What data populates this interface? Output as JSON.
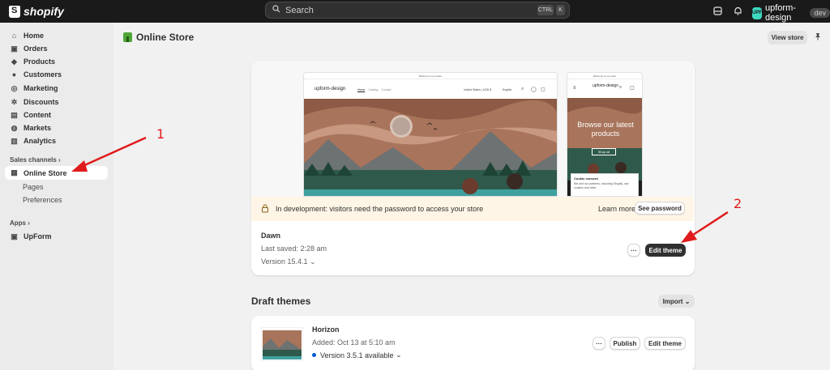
{
  "topbar": {
    "logo_text": "shopify",
    "search_placeholder": "Search",
    "shortcut_ctrl": "CTRL",
    "shortcut_k": "K",
    "store_initials": "UPF",
    "store_name": "upform-design",
    "store_badge": "dev"
  },
  "sidebar": {
    "items": [
      {
        "label": "Home",
        "icon": "home-icon"
      },
      {
        "label": "Orders",
        "icon": "orders-icon"
      },
      {
        "label": "Products",
        "icon": "tag-icon"
      },
      {
        "label": "Customers",
        "icon": "person-icon"
      },
      {
        "label": "Marketing",
        "icon": "target-icon"
      },
      {
        "label": "Discounts",
        "icon": "gear-icon"
      },
      {
        "label": "Content",
        "icon": "file-icon"
      },
      {
        "label": "Markets",
        "icon": "globe-icon"
      },
      {
        "label": "Analytics",
        "icon": "chart-icon"
      }
    ],
    "sales_channels_label": "Sales channels",
    "online_store_label": "Online Store",
    "online_store_sub": [
      "Pages",
      "Preferences"
    ],
    "apps_label": "Apps",
    "upform_label": "UpForm"
  },
  "header": {
    "title": "Online Store",
    "view_store_label": "View store"
  },
  "preview": {
    "announcement": "Welcome to our store",
    "site_name": "upform-design",
    "nav_links": [
      "Home",
      "Catalog",
      "Contact"
    ],
    "locale": "United States | USD $",
    "language": "English",
    "mobile_site_name": "upform-design",
    "mobile_hero_text": "Browse our latest products",
    "mobile_shop_button": "Shop all",
    "cookie_title": "Cookie consent",
    "cookie_text": "We and our partners, including Shopify, use cookies and other"
  },
  "dev_banner": {
    "message": "In development: visitors need the password to access your store",
    "learn_more_label": "Learn more",
    "see_password_label": "See password"
  },
  "current_theme": {
    "name": "Dawn",
    "last_saved": "Last saved: 2:28 am",
    "version": "Version 15.4.1",
    "more_label": "···",
    "edit_label": "Edit theme"
  },
  "drafts": {
    "title": "Draft themes",
    "import_label": "Import",
    "items": [
      {
        "name": "Horizon",
        "added": "Added: Oct 13 at 5:10 am",
        "version": "Version 3.5.1 available",
        "more_label": "···",
        "publish_label": "Publish",
        "edit_label": "Edit theme"
      }
    ]
  },
  "annotations": {
    "label_1": "1",
    "label_2": "2",
    "arrow_color": "#e01b1b"
  },
  "colors": {
    "topbar": "#1a1a1a",
    "sidebar": "#ebebeb",
    "background": "#f1f1f1",
    "primary_button": "#303030",
    "dev_banner": "#fff5e6",
    "version_dot": "#005bd3"
  }
}
